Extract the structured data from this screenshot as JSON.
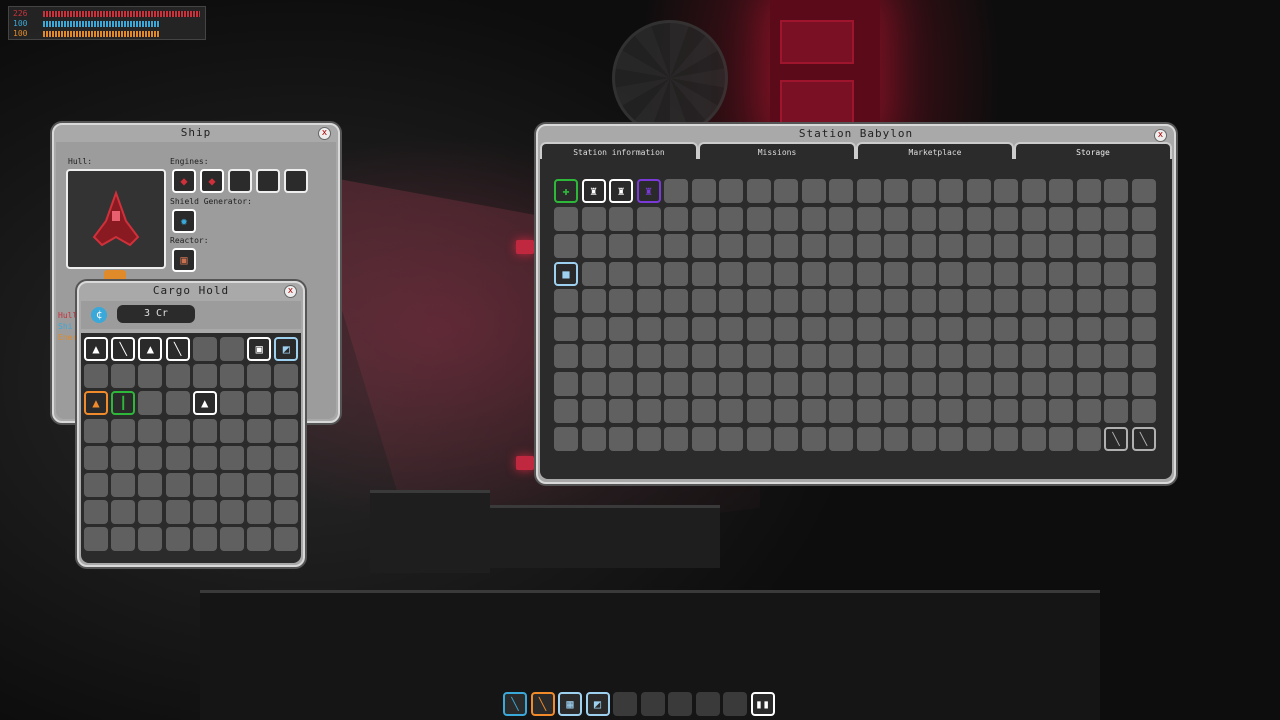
{
  "status": {
    "hull_value": "226",
    "shield_value": "100",
    "energy_value": "100",
    "hull_color": "#c8323c",
    "shield_color": "#3aa8d8",
    "energy_color": "#e08a2a",
    "hull_fill": 0.98,
    "shield_fill": 0.73,
    "energy_fill": 0.73
  },
  "ship_window": {
    "title": "Ship",
    "close_label": "x",
    "hull_label": "Hull:",
    "engines_label": "Engines:",
    "shield_generator_label": "Shield Generator:",
    "reactor_label": "Reactor:",
    "engine_slots": [
      "engine-red",
      "engine-red",
      "empty",
      "empty",
      "empty"
    ],
    "stat_labels": [
      "Hull",
      "Shi",
      "Ener"
    ]
  },
  "cargo_window": {
    "title": "Cargo Hold",
    "close_label": "x",
    "credits": "3 Cr",
    "rows": 8,
    "cols": 8,
    "items": [
      {
        "row": 0,
        "col": 0,
        "icon": "ship-icon",
        "color": "#ffffff",
        "glyph": "▲"
      },
      {
        "row": 0,
        "col": 1,
        "icon": "tube-blue-icon",
        "color": "#ffffff",
        "glyph": "╲"
      },
      {
        "row": 0,
        "col": 2,
        "icon": "ship-gray-icon",
        "color": "#ffffff",
        "glyph": "▲"
      },
      {
        "row": 0,
        "col": 3,
        "icon": "tube-green-icon",
        "color": "#ffffff",
        "glyph": "╲"
      },
      {
        "row": 0,
        "col": 6,
        "icon": "turret-green-icon",
        "color": "#ffffff",
        "glyph": "▣"
      },
      {
        "row": 0,
        "col": 7,
        "icon": "plate-icon",
        "color": "#9ed0f0",
        "glyph": "◩"
      },
      {
        "row": 2,
        "col": 0,
        "icon": "ship-red-icon",
        "color": "#f08a2a",
        "glyph": "▲"
      },
      {
        "row": 2,
        "col": 1,
        "icon": "gun-icon",
        "color": "#2eb83a",
        "glyph": "┃"
      },
      {
        "row": 2,
        "col": 4,
        "icon": "ship-white-icon",
        "color": "#ffffff",
        "glyph": "▲"
      }
    ]
  },
  "station_window": {
    "title": "Station  Babylon",
    "close_label": "x",
    "tabs": [
      "Station information",
      "Missions",
      "Marketplace",
      "Storage"
    ],
    "active_tab": "Storage",
    "rows": 10,
    "cols": 22,
    "items": [
      {
        "row": 0,
        "col": 0,
        "icon": "crosshair-icon",
        "color": "#2eb83a",
        "glyph": "✚"
      },
      {
        "row": 0,
        "col": 1,
        "icon": "robot-icon",
        "color": "#ffffff",
        "glyph": "♜"
      },
      {
        "row": 0,
        "col": 2,
        "icon": "robot-brown-icon",
        "color": "#ffffff",
        "glyph": "♜"
      },
      {
        "row": 0,
        "col": 3,
        "icon": "robot-dark-icon",
        "color": "#7a3ad8",
        "glyph": "♜"
      },
      {
        "row": 3,
        "col": 0,
        "icon": "box-icon",
        "color": "#9ed0f0",
        "glyph": "■"
      },
      {
        "row": 9,
        "col": 20,
        "icon": "tube-blue-icon",
        "color": "#b0b0b0",
        "glyph": "╲"
      },
      {
        "row": 9,
        "col": 21,
        "icon": "tube-green-icon",
        "color": "#b0b0b0",
        "glyph": "╲"
      }
    ]
  },
  "hotbar": {
    "slots": [
      {
        "icon": "laser-red-icon",
        "color": "#3aa8d8",
        "glyph": "╲"
      },
      {
        "icon": "laser-green-icon",
        "color": "#f08a2a",
        "glyph": "╲"
      },
      {
        "icon": "stack-icon",
        "color": "#9ed0f0",
        "glyph": "▦"
      },
      {
        "icon": "dice-icon",
        "color": "#9ed0f0",
        "glyph": "◩"
      },
      {
        "icon": "empty",
        "color": "",
        "glyph": ""
      },
      {
        "icon": "empty",
        "color": "",
        "glyph": ""
      },
      {
        "icon": "empty",
        "color": "",
        "glyph": ""
      },
      {
        "icon": "empty",
        "color": "",
        "glyph": ""
      },
      {
        "icon": "empty",
        "color": "",
        "glyph": ""
      },
      {
        "icon": "pause-icon",
        "color": "#ffffff",
        "glyph": "▮▮"
      }
    ]
  }
}
